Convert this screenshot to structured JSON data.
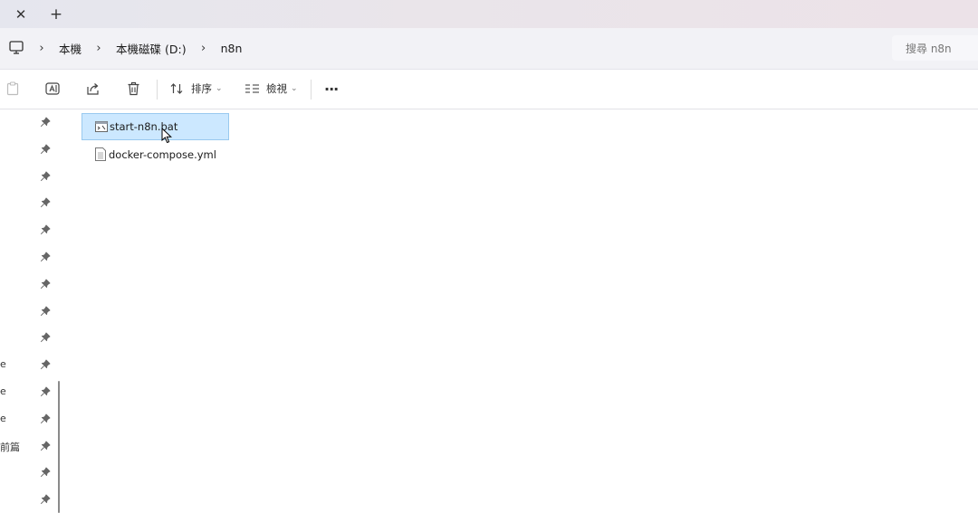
{
  "titlebar": {
    "close_glyph": "✕",
    "new_tab_glyph": "+"
  },
  "address": {
    "crumbs": [
      "本機",
      "本機磁碟 (D:)",
      "n8n"
    ],
    "separator": "›",
    "search_placeholder": "搜尋 n8n"
  },
  "toolbar": {
    "sort_label": "排序",
    "view_label": "檢視",
    "more_glyph": "···"
  },
  "nav": {
    "items": [
      {
        "label": ""
      },
      {
        "label": ""
      },
      {
        "label": ""
      },
      {
        "label": ""
      },
      {
        "label": ""
      },
      {
        "label": ""
      },
      {
        "label": ""
      },
      {
        "label": ""
      },
      {
        "label": ""
      },
      {
        "label": "e"
      },
      {
        "label": "e"
      },
      {
        "label": "e"
      },
      {
        "label": "前篇"
      },
      {
        "label": ""
      },
      {
        "label": ""
      }
    ]
  },
  "files": [
    {
      "name": "start-n8n.bat",
      "type": "bat",
      "selected": true
    },
    {
      "name": "docker-compose.yml",
      "type": "text",
      "selected": false
    }
  ],
  "colors": {
    "selection_bg": "#cce8ff",
    "selection_border": "#99c9ef"
  },
  "icons": {
    "pc": "computer-icon",
    "pin": "pin-icon",
    "bat": "batch-file-icon",
    "yml": "text-file-icon"
  }
}
